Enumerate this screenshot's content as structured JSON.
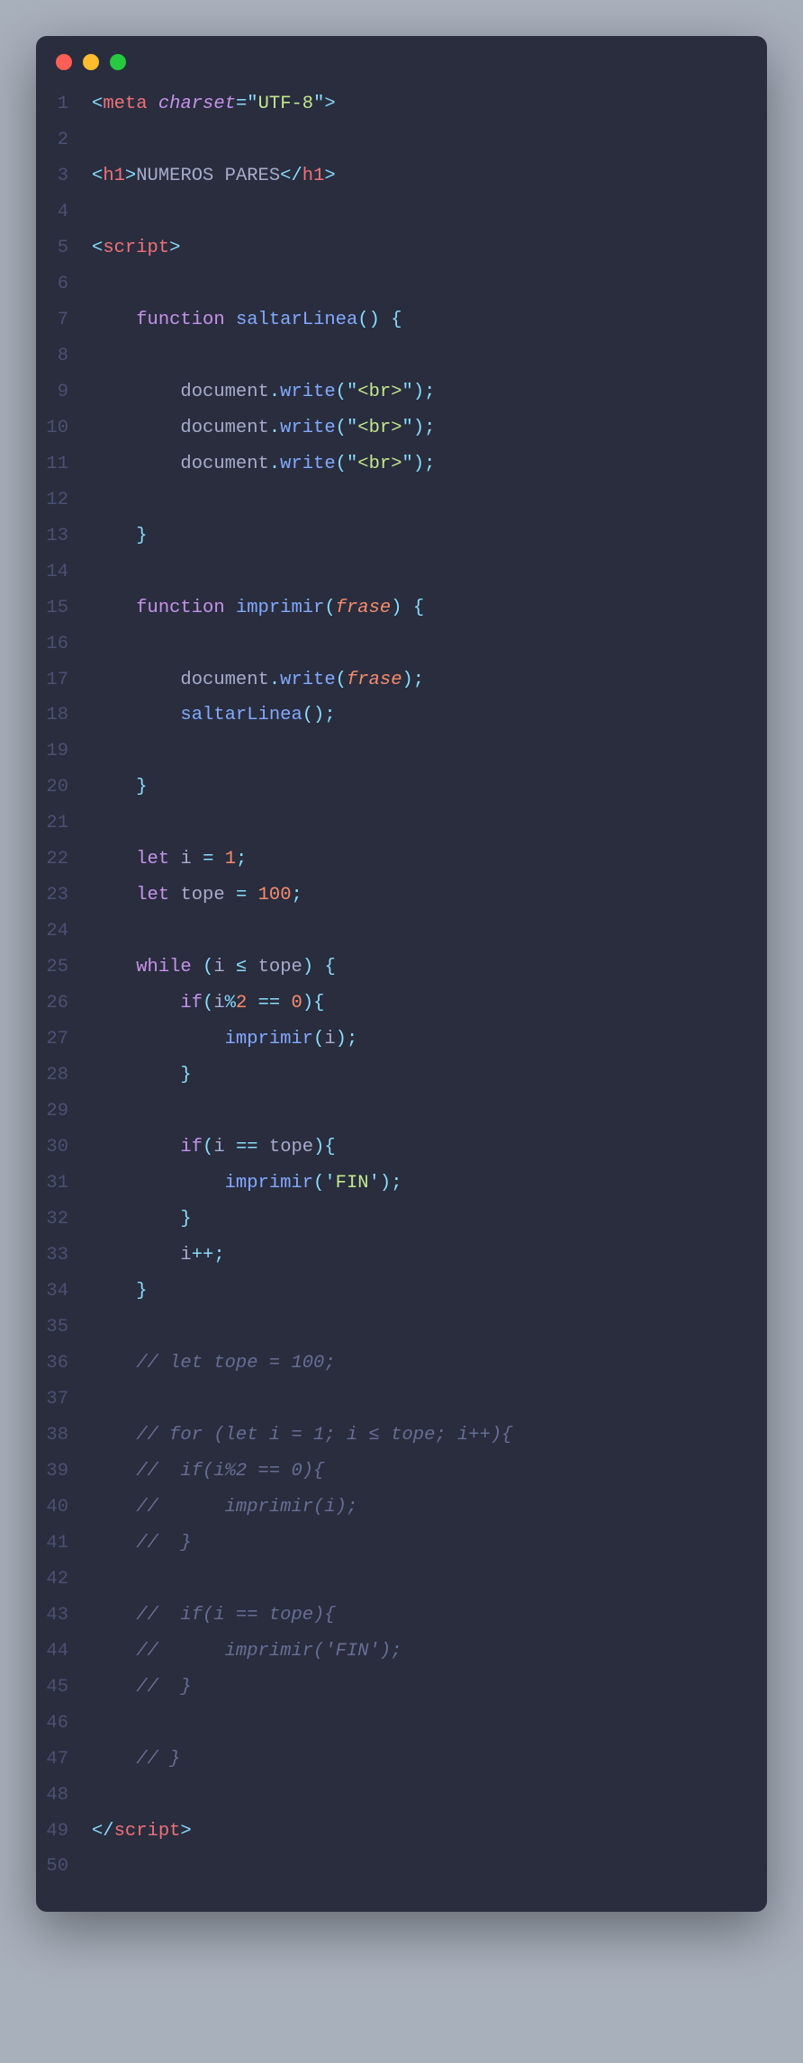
{
  "window": {
    "controls": [
      "close",
      "minimize",
      "maximize"
    ]
  },
  "code": {
    "lines": [
      [
        {
          "cls": "t-punct",
          "t": "<"
        },
        {
          "cls": "t-tag",
          "t": "meta"
        },
        {
          "cls": "",
          "t": " "
        },
        {
          "cls": "t-attr",
          "t": "charset"
        },
        {
          "cls": "t-punct",
          "t": "="
        },
        {
          "cls": "t-punct",
          "t": "\""
        },
        {
          "cls": "t-str",
          "t": "UTF-8"
        },
        {
          "cls": "t-punct",
          "t": "\""
        },
        {
          "cls": "t-punct",
          "t": ">"
        }
      ],
      [],
      [
        {
          "cls": "t-punct",
          "t": "<"
        },
        {
          "cls": "t-tag",
          "t": "h1"
        },
        {
          "cls": "t-punct",
          "t": ">"
        },
        {
          "cls": "t-text",
          "t": "NUMEROS PARES"
        },
        {
          "cls": "t-punct",
          "t": "</"
        },
        {
          "cls": "t-tag",
          "t": "h1"
        },
        {
          "cls": "t-punct",
          "t": ">"
        }
      ],
      [],
      [
        {
          "cls": "t-punct",
          "t": "<"
        },
        {
          "cls": "t-tag",
          "t": "script"
        },
        {
          "cls": "t-punct",
          "t": ">"
        }
      ],
      [],
      [
        {
          "cls": "",
          "t": "    "
        },
        {
          "cls": "t-kw",
          "t": "function"
        },
        {
          "cls": "",
          "t": " "
        },
        {
          "cls": "t-fn",
          "t": "saltarLinea"
        },
        {
          "cls": "t-punct",
          "t": "()"
        },
        {
          "cls": "",
          "t": " "
        },
        {
          "cls": "t-punct",
          "t": "{"
        }
      ],
      [],
      [
        {
          "cls": "",
          "t": "        "
        },
        {
          "cls": "t-obj",
          "t": "document"
        },
        {
          "cls": "t-punct",
          "t": "."
        },
        {
          "cls": "t-prop",
          "t": "write"
        },
        {
          "cls": "t-punct",
          "t": "("
        },
        {
          "cls": "t-punct",
          "t": "\""
        },
        {
          "cls": "t-str",
          "t": "<br>"
        },
        {
          "cls": "t-punct",
          "t": "\""
        },
        {
          "cls": "t-punct",
          "t": ");"
        }
      ],
      [
        {
          "cls": "",
          "t": "        "
        },
        {
          "cls": "t-obj",
          "t": "document"
        },
        {
          "cls": "t-punct",
          "t": "."
        },
        {
          "cls": "t-prop",
          "t": "write"
        },
        {
          "cls": "t-punct",
          "t": "("
        },
        {
          "cls": "t-punct",
          "t": "\""
        },
        {
          "cls": "t-str",
          "t": "<br>"
        },
        {
          "cls": "t-punct",
          "t": "\""
        },
        {
          "cls": "t-punct",
          "t": ");"
        }
      ],
      [
        {
          "cls": "",
          "t": "        "
        },
        {
          "cls": "t-obj",
          "t": "document"
        },
        {
          "cls": "t-punct",
          "t": "."
        },
        {
          "cls": "t-prop",
          "t": "write"
        },
        {
          "cls": "t-punct",
          "t": "("
        },
        {
          "cls": "t-punct",
          "t": "\""
        },
        {
          "cls": "t-str",
          "t": "<br>"
        },
        {
          "cls": "t-punct",
          "t": "\""
        },
        {
          "cls": "t-punct",
          "t": ");"
        }
      ],
      [],
      [
        {
          "cls": "",
          "t": "    "
        },
        {
          "cls": "t-punct",
          "t": "}"
        }
      ],
      [],
      [
        {
          "cls": "",
          "t": "    "
        },
        {
          "cls": "t-kw",
          "t": "function"
        },
        {
          "cls": "",
          "t": " "
        },
        {
          "cls": "t-fn",
          "t": "imprimir"
        },
        {
          "cls": "t-punct",
          "t": "("
        },
        {
          "cls": "t-param",
          "t": "frase"
        },
        {
          "cls": "t-punct",
          "t": ")"
        },
        {
          "cls": "",
          "t": " "
        },
        {
          "cls": "t-punct",
          "t": "{"
        }
      ],
      [],
      [
        {
          "cls": "",
          "t": "        "
        },
        {
          "cls": "t-obj",
          "t": "document"
        },
        {
          "cls": "t-punct",
          "t": "."
        },
        {
          "cls": "t-prop",
          "t": "write"
        },
        {
          "cls": "t-punct",
          "t": "("
        },
        {
          "cls": "t-param",
          "t": "frase"
        },
        {
          "cls": "t-punct",
          "t": ");"
        }
      ],
      [
        {
          "cls": "",
          "t": "        "
        },
        {
          "cls": "t-fn",
          "t": "saltarLinea"
        },
        {
          "cls": "t-punct",
          "t": "();"
        }
      ],
      [],
      [
        {
          "cls": "",
          "t": "    "
        },
        {
          "cls": "t-punct",
          "t": "}"
        }
      ],
      [],
      [
        {
          "cls": "",
          "t": "    "
        },
        {
          "cls": "t-kw",
          "t": "let"
        },
        {
          "cls": "",
          "t": " "
        },
        {
          "cls": "t-var",
          "t": "i"
        },
        {
          "cls": "",
          "t": " "
        },
        {
          "cls": "t-op",
          "t": "="
        },
        {
          "cls": "",
          "t": " "
        },
        {
          "cls": "t-num",
          "t": "1"
        },
        {
          "cls": "t-punct",
          "t": ";"
        }
      ],
      [
        {
          "cls": "",
          "t": "    "
        },
        {
          "cls": "t-kw",
          "t": "let"
        },
        {
          "cls": "",
          "t": " "
        },
        {
          "cls": "t-var",
          "t": "tope"
        },
        {
          "cls": "",
          "t": " "
        },
        {
          "cls": "t-op",
          "t": "="
        },
        {
          "cls": "",
          "t": " "
        },
        {
          "cls": "t-num",
          "t": "100"
        },
        {
          "cls": "t-punct",
          "t": ";"
        }
      ],
      [],
      [
        {
          "cls": "",
          "t": "    "
        },
        {
          "cls": "t-kw",
          "t": "while"
        },
        {
          "cls": "",
          "t": " "
        },
        {
          "cls": "t-punct",
          "t": "("
        },
        {
          "cls": "t-var",
          "t": "i"
        },
        {
          "cls": "",
          "t": " "
        },
        {
          "cls": "t-op",
          "t": "≤"
        },
        {
          "cls": "",
          "t": " "
        },
        {
          "cls": "t-var",
          "t": "tope"
        },
        {
          "cls": "t-punct",
          "t": ")"
        },
        {
          "cls": "",
          "t": " "
        },
        {
          "cls": "t-punct",
          "t": "{"
        }
      ],
      [
        {
          "cls": "",
          "t": "        "
        },
        {
          "cls": "t-kw",
          "t": "if"
        },
        {
          "cls": "t-punct",
          "t": "("
        },
        {
          "cls": "t-var",
          "t": "i"
        },
        {
          "cls": "t-op",
          "t": "%"
        },
        {
          "cls": "t-num",
          "t": "2"
        },
        {
          "cls": "",
          "t": " "
        },
        {
          "cls": "t-op",
          "t": "=="
        },
        {
          "cls": "",
          "t": " "
        },
        {
          "cls": "t-num",
          "t": "0"
        },
        {
          "cls": "t-punct",
          "t": "){"
        }
      ],
      [
        {
          "cls": "",
          "t": "            "
        },
        {
          "cls": "t-fn",
          "t": "imprimir"
        },
        {
          "cls": "t-punct",
          "t": "("
        },
        {
          "cls": "t-var",
          "t": "i"
        },
        {
          "cls": "t-punct",
          "t": ");"
        }
      ],
      [
        {
          "cls": "",
          "t": "        "
        },
        {
          "cls": "t-punct",
          "t": "}"
        }
      ],
      [],
      [
        {
          "cls": "",
          "t": "        "
        },
        {
          "cls": "t-kw",
          "t": "if"
        },
        {
          "cls": "t-punct",
          "t": "("
        },
        {
          "cls": "t-var",
          "t": "i"
        },
        {
          "cls": "",
          "t": " "
        },
        {
          "cls": "t-op",
          "t": "=="
        },
        {
          "cls": "",
          "t": " "
        },
        {
          "cls": "t-var",
          "t": "tope"
        },
        {
          "cls": "t-punct",
          "t": "){"
        }
      ],
      [
        {
          "cls": "",
          "t": "            "
        },
        {
          "cls": "t-fn",
          "t": "imprimir"
        },
        {
          "cls": "t-punct",
          "t": "("
        },
        {
          "cls": "t-punct",
          "t": "'"
        },
        {
          "cls": "t-str",
          "t": "FIN"
        },
        {
          "cls": "t-punct",
          "t": "'"
        },
        {
          "cls": "t-punct",
          "t": ");"
        }
      ],
      [
        {
          "cls": "",
          "t": "        "
        },
        {
          "cls": "t-punct",
          "t": "}"
        }
      ],
      [
        {
          "cls": "",
          "t": "        "
        },
        {
          "cls": "t-var",
          "t": "i"
        },
        {
          "cls": "t-op",
          "t": "++"
        },
        {
          "cls": "t-punct",
          "t": ";"
        }
      ],
      [
        {
          "cls": "",
          "t": "    "
        },
        {
          "cls": "t-punct",
          "t": "}"
        }
      ],
      [],
      [
        {
          "cls": "",
          "t": "    "
        },
        {
          "cls": "t-comment",
          "t": "// let tope = 100;"
        }
      ],
      [],
      [
        {
          "cls": "",
          "t": "    "
        },
        {
          "cls": "t-comment",
          "t": "// for (let i = 1; i ≤ tope; i++){"
        }
      ],
      [
        {
          "cls": "",
          "t": "    "
        },
        {
          "cls": "t-comment",
          "t": "//  if(i%2 == 0){"
        }
      ],
      [
        {
          "cls": "",
          "t": "    "
        },
        {
          "cls": "t-comment",
          "t": "//      imprimir(i);"
        }
      ],
      [
        {
          "cls": "",
          "t": "    "
        },
        {
          "cls": "t-comment",
          "t": "//  }"
        }
      ],
      [],
      [
        {
          "cls": "",
          "t": "    "
        },
        {
          "cls": "t-comment",
          "t": "//  if(i == tope){"
        }
      ],
      [
        {
          "cls": "",
          "t": "    "
        },
        {
          "cls": "t-comment",
          "t": "//      imprimir('FIN');"
        }
      ],
      [
        {
          "cls": "",
          "t": "    "
        },
        {
          "cls": "t-comment",
          "t": "//  }"
        }
      ],
      [],
      [
        {
          "cls": "",
          "t": "    "
        },
        {
          "cls": "t-comment",
          "t": "// }"
        }
      ],
      [],
      [
        {
          "cls": "t-punct",
          "t": "</"
        },
        {
          "cls": "t-tag",
          "t": "script"
        },
        {
          "cls": "t-punct",
          "t": ">"
        }
      ],
      []
    ]
  }
}
